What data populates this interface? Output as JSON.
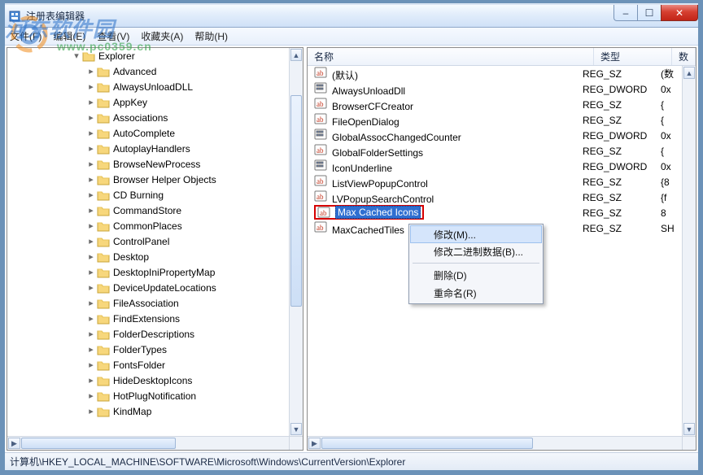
{
  "window": {
    "title": "注册表编辑器"
  },
  "watermark": {
    "line1": "河东软件园",
    "line2": "www.pc0359.cn"
  },
  "menu": {
    "file": "文件(F)",
    "edit": "编辑(E)",
    "view": "查看(V)",
    "favorites": "收藏夹(A)",
    "help": "帮助(H)"
  },
  "winbuttons": {
    "min": "–",
    "max": "☐",
    "close": "✕"
  },
  "tree": {
    "root": "Explorer",
    "children": [
      "Advanced",
      "AlwaysUnloadDLL",
      "AppKey",
      "Associations",
      "AutoComplete",
      "AutoplayHandlers",
      "BrowseNewProcess",
      "Browser Helper Objects",
      "CD Burning",
      "CommandStore",
      "CommonPlaces",
      "ControlPanel",
      "Desktop",
      "DesktopIniPropertyMap",
      "DeviceUpdateLocations",
      "FileAssociation",
      "FindExtensions",
      "FolderDescriptions",
      "FolderTypes",
      "FontsFolder",
      "HideDesktopIcons",
      "HotPlugNotification",
      "KindMap"
    ]
  },
  "columns": {
    "name": "名称",
    "type": "类型",
    "data": "数"
  },
  "rows": [
    {
      "name": "(默认)",
      "type": "REG_SZ",
      "data": "(数",
      "icon": "str"
    },
    {
      "name": "AlwaysUnloadDll",
      "type": "REG_DWORD",
      "data": "0x",
      "icon": "dw"
    },
    {
      "name": "BrowserCFCreator",
      "type": "REG_SZ",
      "data": "{",
      "icon": "str"
    },
    {
      "name": "FileOpenDialog",
      "type": "REG_SZ",
      "data": "{",
      "icon": "str"
    },
    {
      "name": "GlobalAssocChangedCounter",
      "type": "REG_DWORD",
      "data": "0x",
      "icon": "dw"
    },
    {
      "name": "GlobalFolderSettings",
      "type": "REG_SZ",
      "data": "{",
      "icon": "str"
    },
    {
      "name": "IconUnderline",
      "type": "REG_DWORD",
      "data": "0x",
      "icon": "dw"
    },
    {
      "name": "ListViewPopupControl",
      "type": "REG_SZ",
      "data": "{8",
      "icon": "str"
    },
    {
      "name": "LVPopupSearchControl",
      "type": "REG_SZ",
      "data": "{f",
      "icon": "str"
    },
    {
      "name": "Max Cached Icons",
      "type": "REG_SZ",
      "data": "8",
      "icon": "str",
      "selected": true
    },
    {
      "name": "MaxCachedTiles",
      "type": "REG_SZ",
      "data": "SH",
      "icon": "str"
    }
  ],
  "context": {
    "modify": "修改(M)...",
    "modify_binary": "修改二进制数据(B)...",
    "delete": "删除(D)",
    "rename": "重命名(R)"
  },
  "status": "计算机\\HKEY_LOCAL_MACHINE\\SOFTWARE\\Microsoft\\Windows\\CurrentVersion\\Explorer"
}
